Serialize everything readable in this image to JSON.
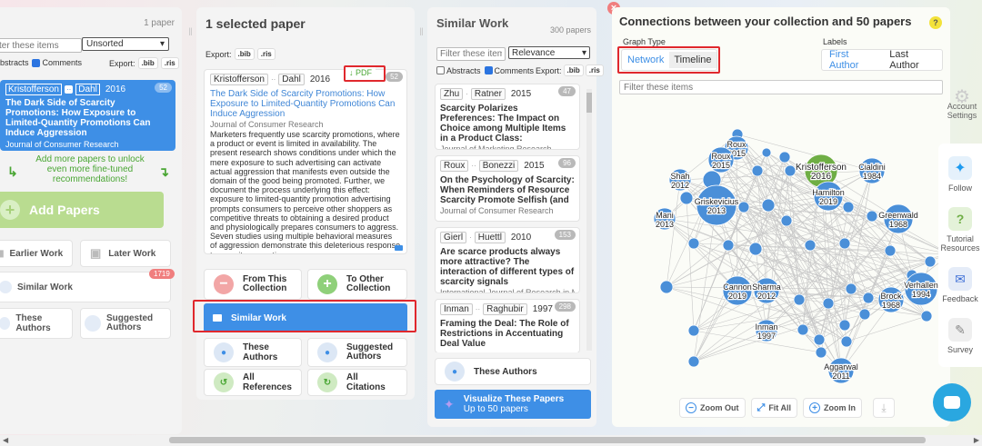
{
  "collection": {
    "count_label": "1 paper",
    "filter_placeholder": "ter these items",
    "sort_value": "Unsorted",
    "abstracts_label": "Abstracts",
    "comments_label": "Comments",
    "export_label": "Export:",
    "bib": ".bib",
    "ris": ".ris",
    "paper": {
      "author1": "Kristofferson",
      "author2": "Dahl",
      "year": "2016",
      "badge": "52",
      "title": "The Dark Side of Scarcity Promotions: How Exposure to Limited-Quantity Promotions Can Induce Aggression",
      "journal": "Journal of Consumer Research"
    },
    "promo": "Add more papers to unlock even more fine-tuned recommendations!",
    "add_label": "Add Papers",
    "nav": {
      "earlier": "Earlier Work",
      "later": "Later Work",
      "similar": "Similar Work",
      "similar_count": "1719",
      "these_authors": "These Authors",
      "suggested": "Suggested Authors"
    }
  },
  "selected": {
    "title": "1 selected paper",
    "export_label": "Export:",
    "bib": ".bib",
    "ris": ".ris",
    "paper": {
      "author1": "Kristofferson",
      "author2": "Dahl",
      "year": "2016",
      "pdf": "↓ PDF",
      "badge": "52",
      "title": "The Dark Side of Scarcity Promotions: How Exposure to Limited-Quantity Promotions Can Induce Aggression",
      "journal": "Journal of Consumer Research",
      "abstract": "Marketers frequently use scarcity promotions, where a product or event is limited in availability. The present research shows conditions under which the mere exposure to such advertising can activate actual aggression that manifests even outside the domain of the good being promoted. Further, we document the process underlying this effect: exposure to limited-quantity promotion advertising prompts consumers to perceive other shoppers as competitive threats to obtaining a desired product and physiologically prepares consumers to aggress. Seven studies using multiple behavioral measures of aggression demonstrate this deleterious response to scarcity promotions."
    },
    "actions": {
      "remove": "From This Collection",
      "add": "To Other Collection",
      "similar": "Similar Work",
      "authors": "These Authors",
      "suggested": "Suggested Authors",
      "refs": "All References",
      "cites": "All Citations"
    }
  },
  "similar": {
    "title": "Similar Work",
    "count_label": "300 papers",
    "filter_placeholder": "Filter these item",
    "sort_value": "Relevance",
    "abstracts_label": "Abstracts",
    "comments_label": "Comments",
    "export_label": "Export:",
    "bib": ".bib",
    "ris": ".ris",
    "papers": [
      {
        "authors": "Zhu · Ratner",
        "year": "2015",
        "badge": "47",
        "title": "Scarcity Polarizes Preferences: The Impact on Choice among Multiple Items in a Product Class:",
        "journal": "Journal of Marketing Research"
      },
      {
        "authors": "Roux ·· Bonezzi",
        "year": "2015",
        "badge": "96",
        "title": "On the Psychology of Scarcity: When Reminders of Resource Scarcity Promote Selfish (and",
        "journal": "Journal of Consumer Research"
      },
      {
        "authors": "Gierl · Huettl",
        "year": "2010",
        "badge": "153",
        "title": "Are scarce products always more attractive? The interaction of different types of scarcity signals",
        "journal": "International Journal of Research in Mar"
      },
      {
        "authors": "Inman ·· Raghubir",
        "year": "1997",
        "badge": "298",
        "title": "Framing the Deal: The Role of Restrictions in Accentuating Deal Value",
        "journal": ""
      }
    ],
    "these_authors": "These Authors",
    "visualize_title": "Visualize These Papers",
    "visualize_sub": "Up to 50 papers"
  },
  "graph": {
    "title": "Connections between your collection and 50 papers",
    "help": "?",
    "graph_type_label": "Graph Type",
    "labels_label": "Labels",
    "network": "Network",
    "timeline": "Timeline",
    "first_author": "First Author",
    "last_author": "Last Author",
    "filter_placeholder": "Filter these items",
    "zoom_out": "Zoom Out",
    "fit_all": "Fit All",
    "zoom_in": "Zoom In",
    "colors": {
      "node": "#4a8fd8",
      "focus": "#6fae45"
    },
    "labels": {
      "kristofferson": "Kristofferson",
      "kristofferson_year": "2016",
      "cialdini": "Cialdini",
      "cialdini_year": "1984",
      "roux": "Roux",
      "roux_year": "2015",
      "shah": "Shah",
      "shah_year": "2012",
      "hamilton": "Hamilton",
      "hamilton_year": "2019",
      "manisi": "Mani",
      "manisi_year": "2013",
      "griskevicius": "Griskevicius",
      "griskevicius_year": "2013",
      "greenwald": "Greenwald",
      "greenwald_year": "1968",
      "ku": "Ku",
      "ku_year": "2012",
      "cannon": "Cannon",
      "cannon_year": "2019",
      "sharma": "Sharma",
      "sharma_year": "2012",
      "verhallen": "Verhallen",
      "verhallen_year": "1994",
      "brock": "Brock",
      "brock_year": "1968",
      "inman": "Inman",
      "inman_year": "1997",
      "aggarwal": "Aggarwal",
      "aggarwal_year": "2011"
    }
  },
  "rightbar": {
    "account": "Account Settings",
    "follow": "Follow",
    "tutorial": "Tutorial Resources",
    "feedback": "Feedback",
    "survey": "Survey"
  }
}
